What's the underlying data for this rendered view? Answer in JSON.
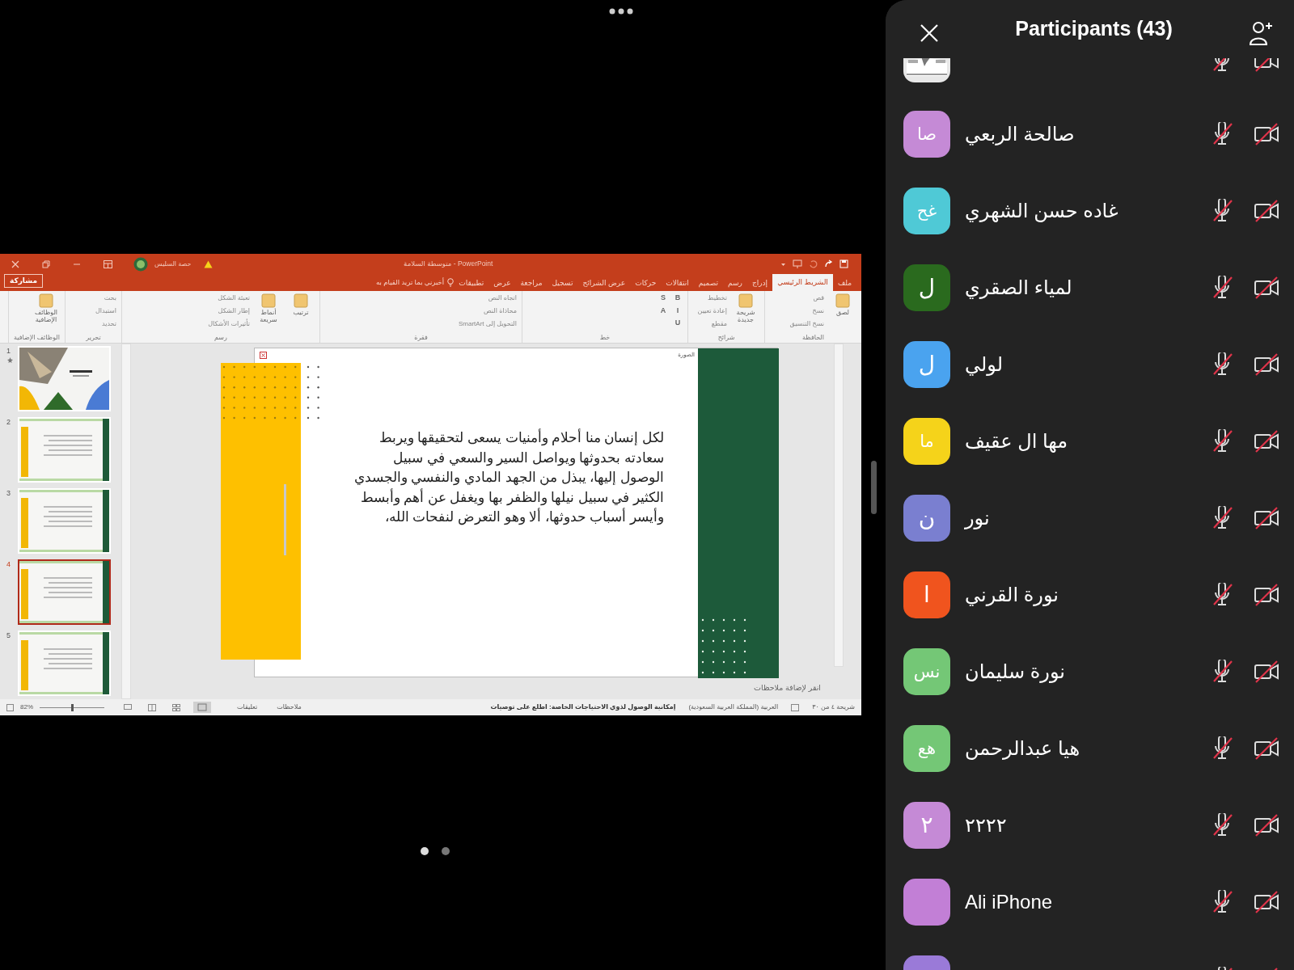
{
  "shared_screen": {
    "title_bar": {
      "user": "حصة السليس",
      "title": "متوسطة السلامة - PowerPoint"
    },
    "share_button": "مشاركة",
    "tell_me": "أخبرني بما تريد القيام به",
    "tabs": [
      {
        "label": "ملف",
        "selected": false
      },
      {
        "label": "الشريط الرئيسي",
        "selected": true
      },
      {
        "label": "إدراج",
        "selected": false
      },
      {
        "label": "رسم",
        "selected": false
      },
      {
        "label": "تصميم",
        "selected": false
      },
      {
        "label": "انتقالات",
        "selected": false
      },
      {
        "label": "حركات",
        "selected": false
      },
      {
        "label": "عرض الشرائح",
        "selected": false
      },
      {
        "label": "تسجيل",
        "selected": false
      },
      {
        "label": "مراجعة",
        "selected": false
      },
      {
        "label": "عرض",
        "selected": false
      },
      {
        "label": "تطبيقات",
        "selected": false
      }
    ],
    "ribbon_groups": [
      {
        "name": "الحافظة",
        "items": [
          {
            "label": "لصق",
            "kind": "large"
          },
          {
            "label": "قص",
            "kind": "small"
          },
          {
            "label": "نسخ",
            "kind": "small"
          },
          {
            "label": "نسخ التنسيق",
            "kind": "small"
          }
        ]
      },
      {
        "name": "شرائح",
        "items": [
          {
            "label": "شريحة جديدة",
            "kind": "large"
          },
          {
            "label": "تخطيط",
            "kind": "small"
          },
          {
            "label": "إعادة تعيين",
            "kind": "small"
          },
          {
            "label": "مقطع",
            "kind": "small"
          }
        ]
      },
      {
        "name": "خط",
        "items": [
          {
            "label": "B",
            "kind": "format"
          },
          {
            "label": "I",
            "kind": "format"
          },
          {
            "label": "U",
            "kind": "format"
          },
          {
            "label": "S",
            "kind": "format"
          },
          {
            "label": "A",
            "kind": "format"
          }
        ]
      },
      {
        "name": "فقرة",
        "items": [
          {
            "label": "اتجاه النص",
            "kind": "small"
          },
          {
            "label": "محاذاة النص",
            "kind": "small"
          },
          {
            "label": "التحويل إلى SmartArt",
            "kind": "small"
          }
        ]
      },
      {
        "name": "رسم",
        "items": [
          {
            "label": "ترتيب",
            "kind": "large"
          },
          {
            "label": "أنماط سريعة",
            "kind": "large"
          },
          {
            "label": "تعبئة الشكل",
            "kind": "small"
          },
          {
            "label": "إطار الشكل",
            "kind": "small"
          },
          {
            "label": "تأثيرات الأشكال",
            "kind": "small"
          }
        ]
      },
      {
        "name": "تحرير",
        "items": [
          {
            "label": "بحث",
            "kind": "small"
          },
          {
            "label": "استبدال",
            "kind": "small"
          },
          {
            "label": "تحديد",
            "kind": "small"
          }
        ]
      },
      {
        "name": "الوظائف الإضافية",
        "items": [
          {
            "label": "الوظائف الإضافية",
            "kind": "large"
          }
        ]
      }
    ],
    "thumbnails": [
      {
        "number": "1",
        "kind": "cover",
        "animated": true,
        "selected": false
      },
      {
        "number": "2",
        "kind": "content",
        "animated": false,
        "selected": false
      },
      {
        "number": "3",
        "kind": "content",
        "animated": false,
        "selected": false
      },
      {
        "number": "4",
        "kind": "content",
        "animated": false,
        "selected": true
      },
      {
        "number": "5",
        "kind": "content",
        "animated": false,
        "selected": false
      }
    ],
    "slide": {
      "placeholder_label": "الصورة",
      "text_lines": [
        "لكل إنسان منا أحلام وأمنيات يسعى لتحقيقها ويربط",
        "سعادته بحدوثها ويواصل السير والسعي في سبيل",
        "الوصول إليها، يبذل من الجهد المادي والنفسي والجسدي",
        "الكثير في سبيل نيلها والظفر بها ويغفل عن أهم وأبسط",
        "وأيسر أسباب حدوثها، ألا وهو التعرض لنفحات الله،"
      ]
    },
    "notes_placeholder": "انقر لإضافة ملاحظات",
    "status_bar": {
      "slide_count": "شريحة ٤ من ٣٠",
      "language": "العربية (المملكة العربية السعودية)",
      "accessibility": "إمكانية الوصول لذوي الاحتياجات الخاصة: اطلع على توصيات",
      "notes": "ملاحظات",
      "comments": "تعليقات",
      "zoom": "82%",
      "zoom_slider": {
        "level": 0.5
      }
    }
  },
  "pages": [
    {
      "selected": true
    },
    {
      "selected": false
    }
  ],
  "participants_panel": {
    "title": "Participants (43)",
    "participants": [
      {
        "kind": "picture",
        "muted": true,
        "video_off": true
      },
      {
        "kind": "initials",
        "name": "صالحة الربعي",
        "initials": "صا",
        "color": "#c58ad6",
        "muted": true,
        "video_off": true
      },
      {
        "kind": "initials",
        "name": "غاده حسن الشهري",
        "initials": "غح",
        "color": "#4fc9d6",
        "muted": true,
        "video_off": true
      },
      {
        "kind": "initials",
        "name": "لمياء الصقري",
        "initials": "ل",
        "color": "#2a6a1e",
        "muted": true,
        "video_off": true
      },
      {
        "kind": "initials",
        "name": "لولي",
        "initials": "ل",
        "color": "#4aa3ef",
        "muted": true,
        "video_off": true
      },
      {
        "kind": "initials",
        "name": "مها ال عقيف",
        "initials": "ما",
        "color": "#f5d31a",
        "muted": true,
        "video_off": true
      },
      {
        "kind": "initials",
        "name": "نور",
        "initials": "ن",
        "color": "#7a7fd0",
        "muted": true,
        "video_off": true
      },
      {
        "kind": "initials",
        "name": "نورة القرني",
        "initials": "ا",
        "color": "#f0541e",
        "muted": true,
        "video_off": true
      },
      {
        "kind": "initials",
        "name": "نورة سليمان",
        "initials": "نس",
        "color": "#74c776",
        "muted": true,
        "video_off": true
      },
      {
        "kind": "initials",
        "name": "هيا عبدالرحمن",
        "initials": "هع",
        "color": "#74c776",
        "muted": true,
        "video_off": true
      },
      {
        "kind": "initials",
        "name": "٢٢٢٢",
        "initials": "٢",
        "color": "#c58ad6",
        "muted": true,
        "video_off": true
      },
      {
        "kind": "initials",
        "name": "Ali iPhone",
        "color": "#c27fd6",
        "muted": true,
        "video_off": true
      },
      {
        "kind": "initials",
        "color": "#9a7ad8",
        "muted": true,
        "video_off": true
      }
    ]
  }
}
